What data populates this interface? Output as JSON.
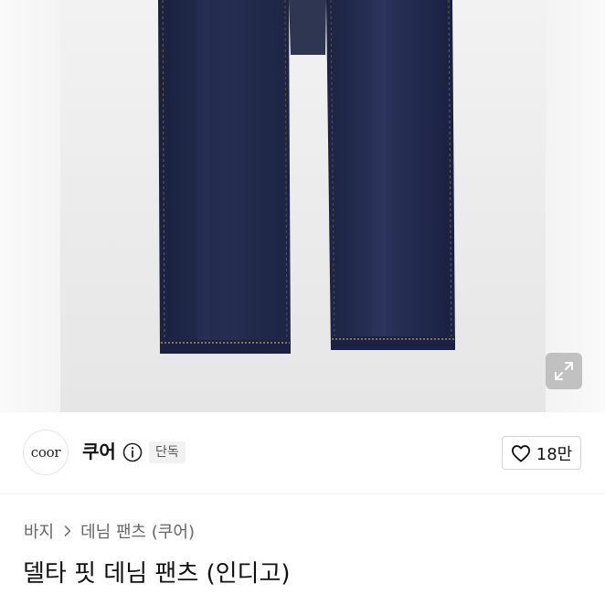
{
  "product_image": {
    "alt": "",
    "expand_icon": "expand-arrows-icon"
  },
  "brand": {
    "logo_text": "coor",
    "name": "쿠어",
    "info_icon": "info-icon",
    "badge": "단독"
  },
  "like": {
    "icon": "heart-outline-icon",
    "count": "18만"
  },
  "breadcrumb": {
    "items": [
      "바지",
      "데님 팬츠 (쿠어)"
    ],
    "separator_icon": "chevron-right-icon"
  },
  "product": {
    "title": "델타 핏 데님 팬츠 (인디고)"
  },
  "colors": {
    "denim": "#1c2340",
    "denim_highlight": "#2c3558",
    "stitch": "#c9a46a",
    "background": "#ececec",
    "text_primary": "#111111",
    "text_secondary": "#666666"
  }
}
